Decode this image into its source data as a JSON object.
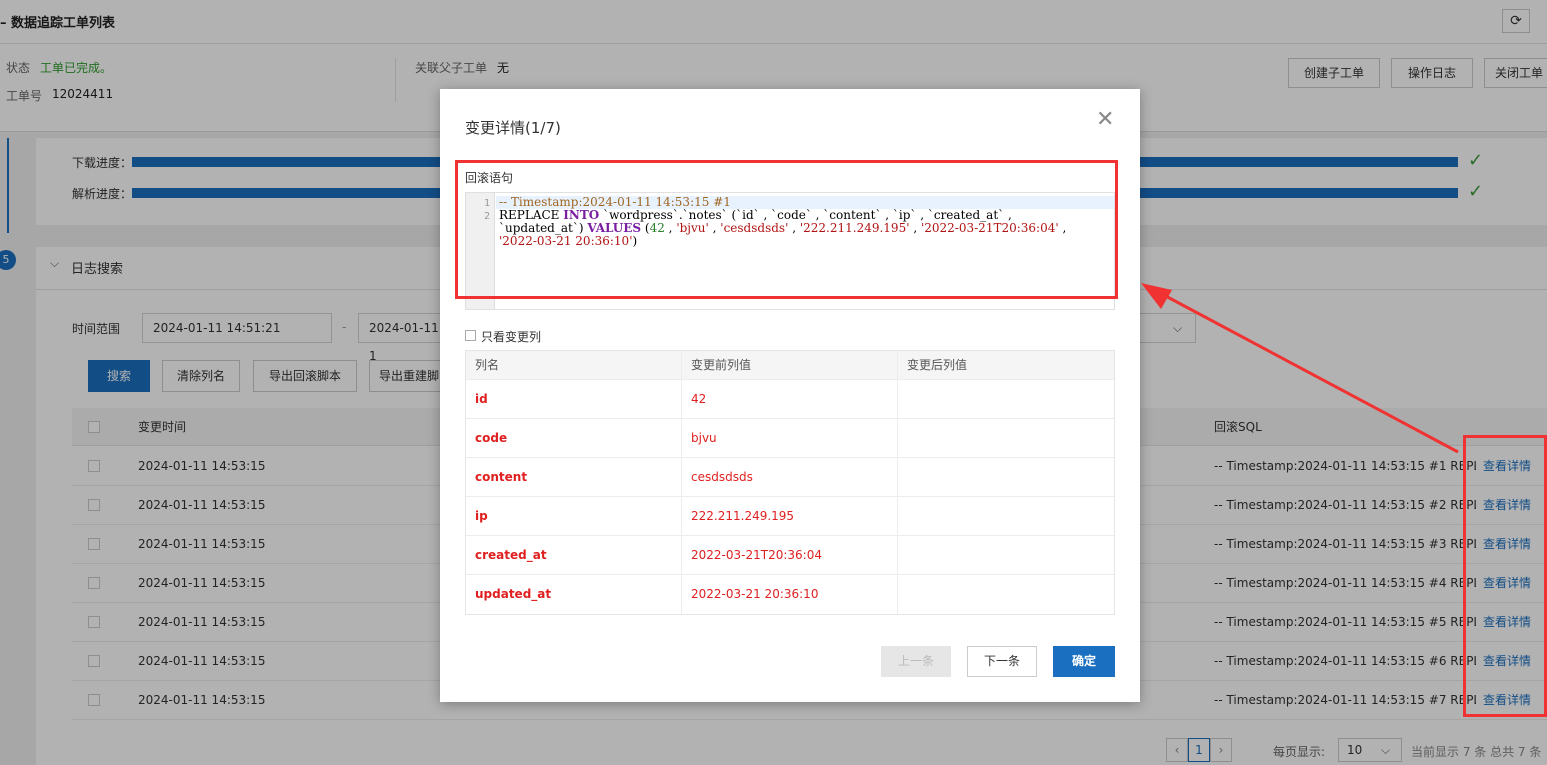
{
  "header": {
    "title": "– 数据追踪工单列表",
    "refresh_icon": "⟳"
  },
  "info": {
    "status_label": "状态",
    "status_value": "工单已完成。",
    "ticket_label": "工单号",
    "ticket_value": "12024411",
    "related_label": "关联父子工单",
    "related_value": "无",
    "buttons": [
      "创建子工单",
      "操作日志",
      "关闭工单"
    ]
  },
  "progress": {
    "download_label": "下载进度：",
    "parse_label": "解析进度：",
    "download_fraction": 1.0,
    "parse_fraction": 1.0,
    "check_icon": "✓"
  },
  "step_number": "5",
  "log_search": {
    "title": "日志搜索",
    "collapse_icon": "⌵",
    "time_range_label": "时间范围",
    "start_date": "2024-01-11 14:51:21",
    "date_separator": "-",
    "end_date": "2024-01-11 1",
    "buttons": {
      "search": "搜索",
      "clear_columns": "清除列名",
      "export_rollback": "导出回滚脚本",
      "export_rebuild": "导出重建脚"
    }
  },
  "table": {
    "headers": {
      "change_time": "变更时间",
      "rollback_sql": "回滚SQL"
    },
    "rows": [
      {
        "time": "2024-01-11 14:53:15",
        "sql": "-- Timestamp:2024-01-11 14:53:15 #1 REPLAC...",
        "action": "查看详情"
      },
      {
        "time": "2024-01-11 14:53:15",
        "sql": "-- Timestamp:2024-01-11 14:53:15 #2 REPLAC...",
        "action": "查看详情"
      },
      {
        "time": "2024-01-11 14:53:15",
        "sql": "-- Timestamp:2024-01-11 14:53:15 #3 REPLAC...",
        "action": "查看详情"
      },
      {
        "time": "2024-01-11 14:53:15",
        "sql": "-- Timestamp:2024-01-11 14:53:15 #4 REPLAC...",
        "action": "查看详情"
      },
      {
        "time": "2024-01-11 14:53:15",
        "sql": "-- Timestamp:2024-01-11 14:53:15 #5 REPLAC...",
        "action": "查看详情"
      },
      {
        "time": "2024-01-11 14:53:15",
        "sql": "-- Timestamp:2024-01-11 14:53:15 #6 REPLAC...",
        "action": "查看详情"
      },
      {
        "time": "2024-01-11 14:53:15",
        "sql": "-- Timestamp:2024-01-11 14:53:15 #7 REPLAC...",
        "action": "查看详情"
      }
    ]
  },
  "pagination": {
    "prev_icon": "‹",
    "next_icon": "›",
    "current_page": "1",
    "per_page_label": "每页显示:",
    "per_page_value": "10",
    "summary": "当前显示 7 条 总共 7 条"
  },
  "modal": {
    "title": "变更详情(1/7)",
    "close_icon": "✕",
    "code_label": "回滚语句",
    "code_lines": [
      "1",
      "2"
    ],
    "code": {
      "comment": "-- Timestamp:2024-01-11 14:53:15 #1",
      "kw_replace": "REPLACE",
      "kw_into": "INTO",
      "table_and_cols": " `wordpress`.`notes` (`id` , `code` , `content` , `ip` , `created_at` , `updated_at`) ",
      "kw_values": "VALUES",
      "open": " (",
      "v_id": "42",
      "sep1": " , ",
      "v_code": "'bjvu'",
      "sep2": " , ",
      "v_content": "'cesdsdsds'",
      "sep3": " , ",
      "v_ip": "'222.211.249.195'",
      "sep4": " , ",
      "v_created": "'2022-03-21T20:36:04'",
      "sep5": " , ",
      "v_updated": "'2022-03-21 20:36:10'",
      "close": ")"
    },
    "only_changed_label": "只看变更列",
    "columns_table": {
      "headers": [
        "列名",
        "变更前列值",
        "变更后列值"
      ],
      "rows": [
        {
          "name": "id",
          "before": "42",
          "after": ""
        },
        {
          "name": "code",
          "before": "bjvu",
          "after": ""
        },
        {
          "name": "content",
          "before": "cesdsdsds",
          "after": ""
        },
        {
          "name": "ip",
          "before": "222.211.249.195",
          "after": ""
        },
        {
          "name": "created_at",
          "before": "2022-03-21T20:36:04",
          "after": ""
        },
        {
          "name": "updated_at",
          "before": "2022-03-21 20:36:10",
          "after": ""
        }
      ]
    },
    "buttons": {
      "prev": "上一条",
      "next": "下一条",
      "ok": "确定"
    }
  },
  "colors": {
    "primary": "#1a6fc1",
    "annotation_red": "#f03232",
    "success_green": "#3a9b3a",
    "changed_red": "#e02020"
  }
}
